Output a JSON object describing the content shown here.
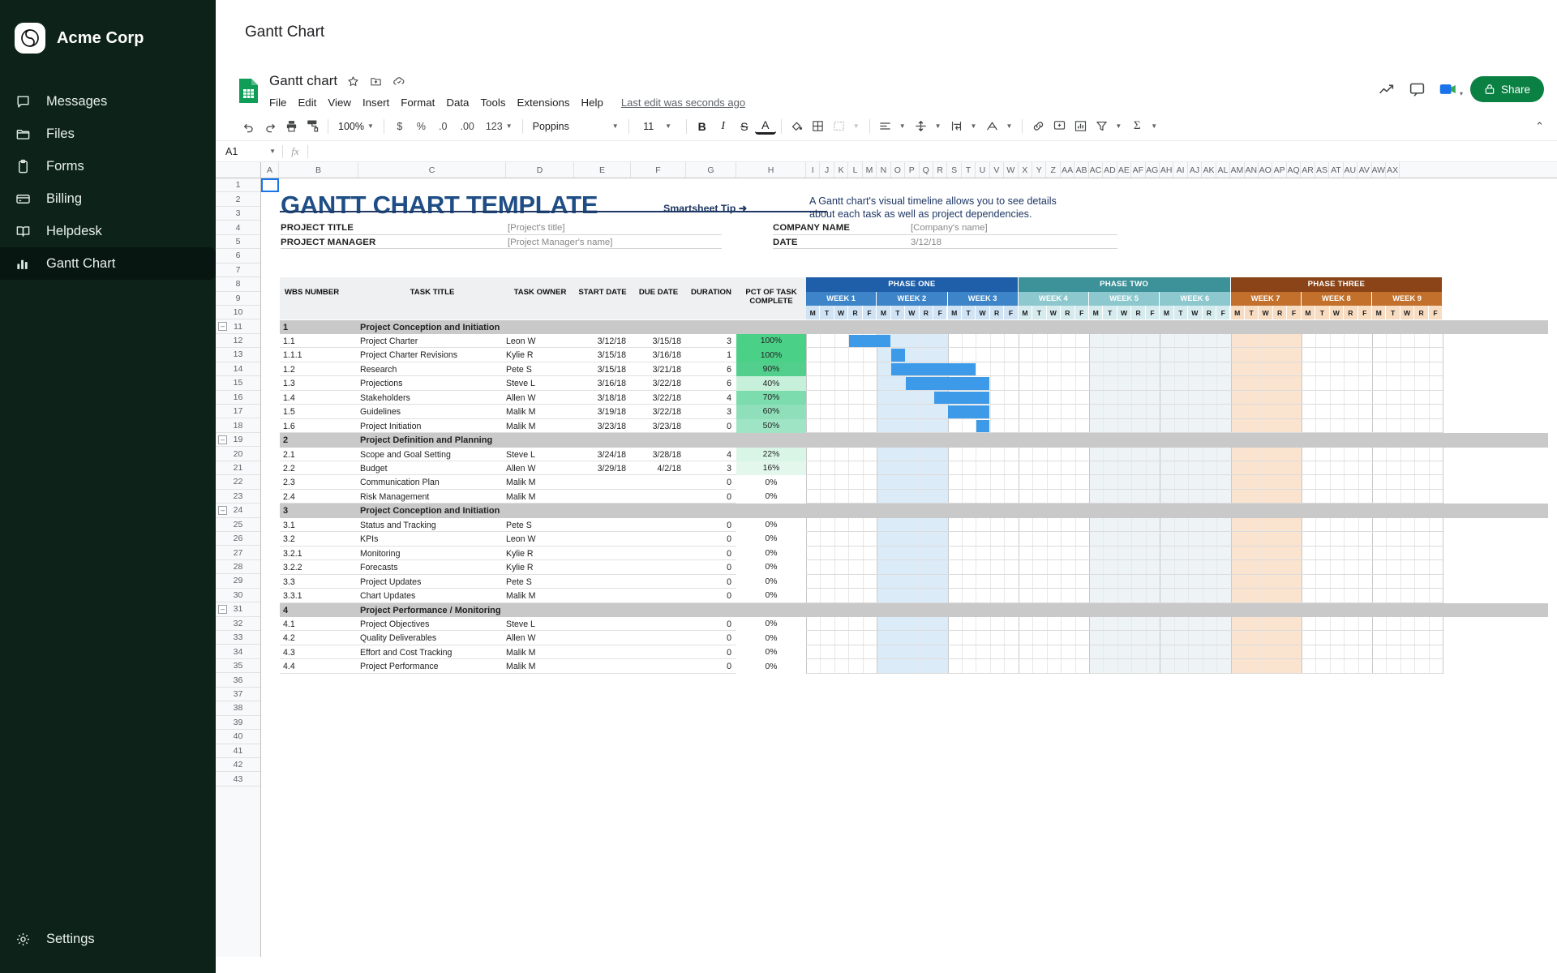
{
  "sidebar": {
    "brand": "Acme Corp",
    "items": [
      {
        "label": "Messages",
        "icon": "message-icon"
      },
      {
        "label": "Files",
        "icon": "folder-icon"
      },
      {
        "label": "Forms",
        "icon": "clipboard-icon"
      },
      {
        "label": "Billing",
        "icon": "card-icon"
      },
      {
        "label": "Helpdesk",
        "icon": "book-icon"
      },
      {
        "label": "Gantt Chart",
        "icon": "chart-icon"
      }
    ],
    "active_index": 5,
    "settings": "Settings"
  },
  "topbar": {
    "title": "Gantt Chart"
  },
  "sheet": {
    "doc_title": "Gantt chart",
    "menus": [
      "File",
      "Edit",
      "View",
      "Insert",
      "Format",
      "Data",
      "Tools",
      "Extensions",
      "Help"
    ],
    "last_edit": "Last edit was seconds ago",
    "share_label": "Share",
    "toolbar": {
      "zoom": "100%",
      "currency": "$",
      "percent": "%",
      "dec_less": ".0",
      "dec_more": ".00",
      "format": "123",
      "font": "Poppins",
      "font_size": "11",
      "bold": "B",
      "italic": "I",
      "strike": "S",
      "text_color": "A"
    },
    "namebox": "A1",
    "formula": "",
    "columns": [
      "A",
      "B",
      "C",
      "D",
      "E",
      "F",
      "G",
      "H",
      "I",
      "J",
      "K",
      "L",
      "M",
      "N",
      "O",
      "P",
      "Q",
      "R",
      "S",
      "T",
      "U",
      "V",
      "W",
      "X",
      "Y",
      "Z",
      "AA",
      "AB",
      "AC",
      "AD",
      "AE",
      "AF",
      "AG",
      "AH",
      "AI",
      "AJ",
      "AK",
      "AL",
      "AM",
      "AN",
      "AO",
      "AP",
      "AQ",
      "AR",
      "AS",
      "AT",
      "AU",
      "AV",
      "AW",
      "AX"
    ],
    "rows": [
      1,
      2,
      3,
      4,
      5,
      6,
      7,
      8,
      9,
      10,
      11,
      12,
      13,
      14,
      15,
      16,
      17,
      18,
      19,
      20,
      21,
      22,
      23,
      24,
      25,
      26,
      27,
      28,
      29,
      30,
      31,
      32,
      33,
      34,
      35,
      36,
      37,
      38,
      39,
      40,
      41,
      42,
      43
    ]
  },
  "doc": {
    "title": "GANTT CHART TEMPLATE",
    "tip_label": "Smartsheet Tip ➜",
    "tip_text_1": "A Gantt chart's visual timeline allows you to see details",
    "tip_text_2": "about each task as well as project dependencies.",
    "fields": [
      {
        "label": "PROJECT TITLE",
        "value": "[Project's title]"
      },
      {
        "label": "PROJECT MANAGER",
        "value": "[Project Manager's name]"
      },
      {
        "label": "COMPANY NAME",
        "value": "[Company's name]"
      },
      {
        "label": "DATE",
        "value": "3/12/18"
      }
    ]
  },
  "chart_data": {
    "type": "bar",
    "title": "GANTT CHART TEMPLATE",
    "headers": [
      "WBS NUMBER",
      "TASK TITLE",
      "TASK OWNER",
      "START DATE",
      "DUE DATE",
      "DURATION",
      "PCT OF TASK COMPLETE"
    ],
    "phases": [
      {
        "name": "PHASE ONE",
        "color": "#1f5fa9",
        "weeks": [
          "WEEK 1",
          "WEEK 2",
          "WEEK 3"
        ],
        "week_color": "#3d85c8",
        "day_color": "#cfe3f5"
      },
      {
        "name": "PHASE TWO",
        "color": "#3d9199",
        "weeks": [
          "WEEK 4",
          "WEEK 5",
          "WEEK 6"
        ],
        "week_color": "#8cc8ce",
        "day_color": "#d6ebee"
      },
      {
        "name": "PHASE THREE",
        "color": "#8a4418",
        "weeks": [
          "WEEK 7",
          "WEEK 8",
          "WEEK 9"
        ],
        "week_color": "#c2702c",
        "day_color": "#f7dcc2"
      }
    ],
    "days": [
      "M",
      "T",
      "W",
      "R",
      "F"
    ],
    "rows": [
      {
        "type": "section",
        "wbs": "1",
        "title": "Project Conception and Initiation"
      },
      {
        "type": "task",
        "wbs": "1.1",
        "title": "Project Charter",
        "owner": "Leon W",
        "start": "3/12/18",
        "due": "3/15/18",
        "duration": "3",
        "pct": "100%",
        "pct_fill": "#4bd088",
        "bar_start": 3,
        "bar_len": 3
      },
      {
        "type": "task",
        "wbs": "1.1.1",
        "title": "Project Charter Revisions",
        "owner": "Kylie R",
        "start": "3/15/18",
        "due": "3/16/18",
        "duration": "1",
        "pct": "100%",
        "pct_fill": "#4bd088",
        "bar_start": 6,
        "bar_len": 1
      },
      {
        "type": "task",
        "wbs": "1.2",
        "title": "Research",
        "owner": "Pete S",
        "start": "3/15/18",
        "due": "3/21/18",
        "duration": "6",
        "pct": "90%",
        "pct_fill": "#52cf8c",
        "bar_start": 6,
        "bar_len": 6
      },
      {
        "type": "task",
        "wbs": "1.3",
        "title": "Projections",
        "owner": "Steve L",
        "start": "3/16/18",
        "due": "3/22/18",
        "duration": "6",
        "pct": "40%",
        "pct_fill": "#c6f0d9",
        "bar_start": 7,
        "bar_len": 6
      },
      {
        "type": "task",
        "wbs": "1.4",
        "title": "Stakeholders",
        "owner": "Allen W",
        "start": "3/18/18",
        "due": "3/22/18",
        "duration": "4",
        "pct": "70%",
        "pct_fill": "#7ddcae",
        "bar_start": 9,
        "bar_len": 4
      },
      {
        "type": "task",
        "wbs": "1.5",
        "title": "Guidelines",
        "owner": "Malik M",
        "start": "3/19/18",
        "due": "3/22/18",
        "duration": "3",
        "pct": "60%",
        "pct_fill": "#8fe0ba",
        "bar_start": 10,
        "bar_len": 3
      },
      {
        "type": "task",
        "wbs": "1.6",
        "title": "Project Initiation",
        "owner": "Malik M",
        "start": "3/23/18",
        "due": "3/23/18",
        "duration": "0",
        "pct": "50%",
        "pct_fill": "#9fe5c5",
        "bar_start": 12,
        "bar_len": 1
      },
      {
        "type": "section",
        "wbs": "2",
        "title": "Project Definition and Planning"
      },
      {
        "type": "task",
        "wbs": "2.1",
        "title": "Scope and Goal Setting",
        "owner": "Steve L",
        "start": "3/24/18",
        "due": "3/28/18",
        "duration": "4",
        "pct": "22%",
        "pct_fill": "#d9f5e6",
        "bar_start": -1,
        "bar_len": 0
      },
      {
        "type": "task",
        "wbs": "2.2",
        "title": "Budget",
        "owner": "Allen W",
        "start": "3/29/18",
        "due": "4/2/18",
        "duration": "3",
        "pct": "16%",
        "pct_fill": "#e3f7ed",
        "bar_start": -1,
        "bar_len": 0
      },
      {
        "type": "task",
        "wbs": "2.3",
        "title": "Communication Plan",
        "owner": "Malik M",
        "start": "",
        "due": "",
        "duration": "0",
        "pct": "0%",
        "pct_fill": "#ffffff",
        "bar_start": -1,
        "bar_len": 0
      },
      {
        "type": "task",
        "wbs": "2.4",
        "title": "Risk Management",
        "owner": "Malik M",
        "start": "",
        "due": "",
        "duration": "0",
        "pct": "0%",
        "pct_fill": "#ffffff",
        "bar_start": -1,
        "bar_len": 0
      },
      {
        "type": "section",
        "wbs": "3",
        "title": "Project Conception and Initiation"
      },
      {
        "type": "task",
        "wbs": "3.1",
        "title": "Status and Tracking",
        "owner": "Pete S",
        "start": "",
        "due": "",
        "duration": "0",
        "pct": "0%",
        "pct_fill": "#ffffff",
        "bar_start": -1,
        "bar_len": 0
      },
      {
        "type": "task",
        "wbs": "3.2",
        "title": "KPIs",
        "owner": "Leon W",
        "start": "",
        "due": "",
        "duration": "0",
        "pct": "0%",
        "pct_fill": "#ffffff",
        "bar_start": -1,
        "bar_len": 0
      },
      {
        "type": "task",
        "wbs": "3.2.1",
        "title": "Monitoring",
        "owner": "Kylie R",
        "start": "",
        "due": "",
        "duration": "0",
        "pct": "0%",
        "pct_fill": "#ffffff",
        "bar_start": -1,
        "bar_len": 0
      },
      {
        "type": "task",
        "wbs": "3.2.2",
        "title": "Forecasts",
        "owner": "Kylie R",
        "start": "",
        "due": "",
        "duration": "0",
        "pct": "0%",
        "pct_fill": "#ffffff",
        "bar_start": -1,
        "bar_len": 0
      },
      {
        "type": "task",
        "wbs": "3.3",
        "title": "Project Updates",
        "owner": "Pete S",
        "start": "",
        "due": "",
        "duration": "0",
        "pct": "0%",
        "pct_fill": "#ffffff",
        "bar_start": -1,
        "bar_len": 0
      },
      {
        "type": "task",
        "wbs": "3.3.1",
        "title": "Chart Updates",
        "owner": "Malik M",
        "start": "",
        "due": "",
        "duration": "0",
        "pct": "0%",
        "pct_fill": "#ffffff",
        "bar_start": -1,
        "bar_len": 0
      },
      {
        "type": "section",
        "wbs": "4",
        "title": "Project Performance / Monitoring"
      },
      {
        "type": "task",
        "wbs": "4.1",
        "title": "Project Objectives",
        "owner": "Steve L",
        "start": "",
        "due": "",
        "duration": "0",
        "pct": "0%",
        "pct_fill": "#ffffff",
        "bar_start": -1,
        "bar_len": 0
      },
      {
        "type": "task",
        "wbs": "4.2",
        "title": "Quality Deliverables",
        "owner": "Allen W",
        "start": "",
        "due": "",
        "duration": "0",
        "pct": "0%",
        "pct_fill": "#ffffff",
        "bar_start": -1,
        "bar_len": 0
      },
      {
        "type": "task",
        "wbs": "4.3",
        "title": "Effort and Cost Tracking",
        "owner": "Malik M",
        "start": "",
        "due": "",
        "duration": "0",
        "pct": "0%",
        "pct_fill": "#ffffff",
        "bar_start": -1,
        "bar_len": 0
      },
      {
        "type": "task",
        "wbs": "4.4",
        "title": "Project Performance",
        "owner": "Malik M",
        "start": "",
        "due": "",
        "duration": "0",
        "pct": "0%",
        "pct_fill": "#ffffff",
        "bar_start": -1,
        "bar_len": 0
      }
    ],
    "bar_color": "#3d9ae8",
    "xlabel": "",
    "ylabel": "",
    "grid": true,
    "legend": "none"
  },
  "colors": {
    "accent": "#0b8043",
    "sidebar_bg": "#0d2319",
    "title_blue": "#1f4e86",
    "phase_one": "#1f5fa9",
    "phase_two": "#3d9199",
    "phase_three": "#8a4418"
  }
}
